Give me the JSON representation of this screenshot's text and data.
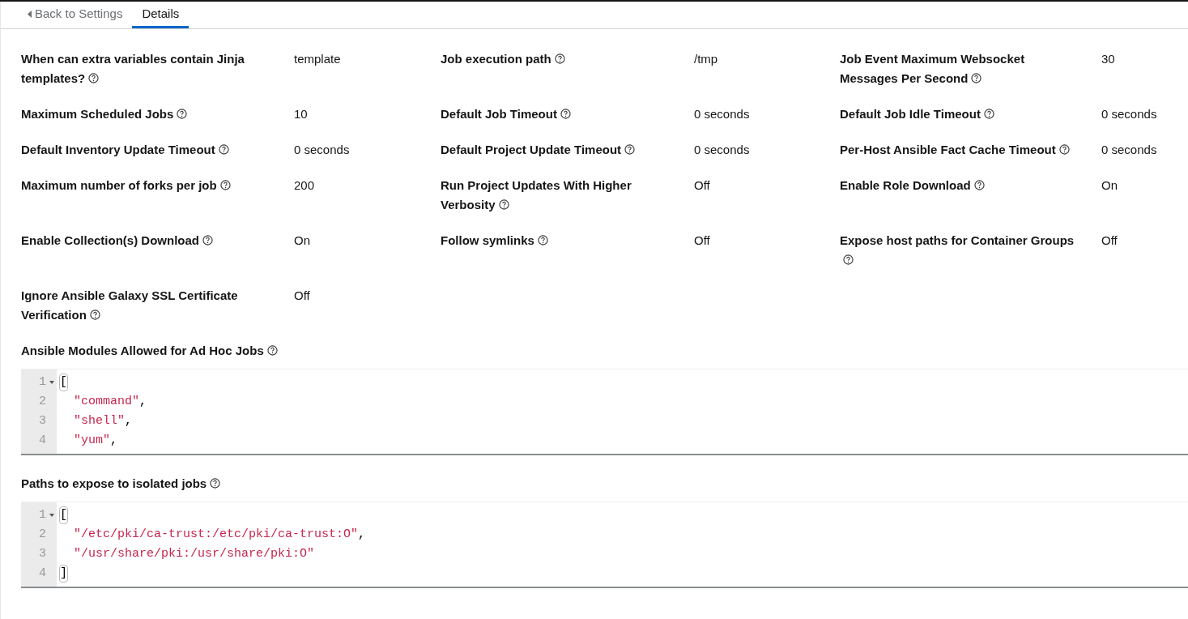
{
  "tabs": [
    {
      "label": "Back to Settings",
      "kind": "back",
      "selected": false
    },
    {
      "label": "Details",
      "kind": "tab",
      "selected": true
    }
  ],
  "settings": [
    {
      "label": "When can extra variables contain Jinja templates?",
      "value": "template"
    },
    {
      "label": "Job execution path",
      "value": "/tmp"
    },
    {
      "label": "Job Event Maximum Websocket Messages Per Second",
      "value": "30"
    },
    {
      "label": "Maximum Scheduled Jobs",
      "value": "10"
    },
    {
      "label": "Default Job Timeout",
      "value": "0 seconds"
    },
    {
      "label": "Default Job Idle Timeout",
      "value": "0 seconds"
    },
    {
      "label": "Default Inventory Update Timeout",
      "value": "0 seconds"
    },
    {
      "label": "Default Project Update Timeout",
      "value": "0 seconds"
    },
    {
      "label": "Per-Host Ansible Fact Cache Timeout",
      "value": "0 seconds"
    },
    {
      "label": "Maximum number of forks per job",
      "value": "200"
    },
    {
      "label": "Run Project Updates With Higher Verbosity",
      "value": "Off"
    },
    {
      "label": "Enable Role Download",
      "value": "On"
    },
    {
      "label": "Enable Collection(s) Download",
      "value": "On"
    },
    {
      "label": "Follow symlinks",
      "value": "Off"
    },
    {
      "label": "Expose host paths for Container Groups",
      "value": "Off"
    },
    {
      "label": "Ignore Ansible Galaxy SSL Certificate Verification",
      "value": "Off"
    }
  ],
  "editors": [
    {
      "label": "Ansible Modules Allowed for Ad Hoc Jobs",
      "lines": [
        {
          "number": "1",
          "kind": "bracket",
          "text": "[",
          "fold": true
        },
        {
          "number": "2",
          "kind": "string",
          "text": "\"command\"",
          "punct": ",",
          "fold": false
        },
        {
          "number": "3",
          "kind": "string",
          "text": "\"shell\"",
          "punct": ",",
          "fold": false
        },
        {
          "number": "4",
          "kind": "string",
          "text": "\"yum\"",
          "punct": ",",
          "fold": false
        }
      ]
    },
    {
      "label": "Paths to expose to isolated jobs",
      "lines": [
        {
          "number": "1",
          "kind": "bracket",
          "text": "[",
          "fold": true
        },
        {
          "number": "2",
          "kind": "string",
          "text": "\"/etc/pki/ca-trust:/etc/pki/ca-trust:O\"",
          "punct": ",",
          "fold": false
        },
        {
          "number": "3",
          "kind": "string",
          "text": "\"/usr/share/pki:/usr/share/pki:O\"",
          "fold": false
        },
        {
          "number": "4",
          "kind": "bracket",
          "text": "]",
          "fold": false
        }
      ]
    }
  ]
}
